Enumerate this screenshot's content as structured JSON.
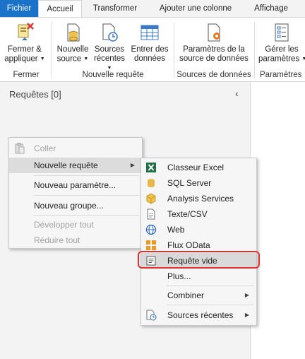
{
  "ribbon_tabs": [
    "Fichier",
    "Accueil",
    "Transformer",
    "Ajouter une colonne",
    "Affichage"
  ],
  "ribbon": {
    "close_apply": {
      "line1": "Fermer &",
      "line2": "appliquer"
    },
    "new_source": {
      "line1": "Nouvelle",
      "line2": "source"
    },
    "recent_sources": {
      "line1": "Sources",
      "line2": "récentes"
    },
    "enter_data": {
      "line1": "Entrer des",
      "line2": "données"
    },
    "data_source_settings": {
      "line1": "Paramètres de la",
      "line2": "source de données"
    },
    "manage_params": {
      "line1": "Gérer les",
      "line2": "paramètres"
    },
    "groups": {
      "close": "Fermer",
      "new_query": "Nouvelle requête",
      "data_sources": "Sources de données",
      "params": "Paramètres"
    }
  },
  "queries_pane": {
    "title": "Requêtes [0]",
    "collapse_icon": "chevron-left-icon"
  },
  "context_menu": {
    "items": [
      {
        "label": "Coller",
        "disabled": true
      },
      {
        "label": "Nouvelle requête",
        "submenu": true
      },
      {
        "label": "Nouveau paramètre..."
      },
      {
        "label": "Nouveau groupe..."
      },
      {
        "label": "Développer tout",
        "disabled": true
      },
      {
        "label": "Réduire tout",
        "disabled": true
      }
    ]
  },
  "submenu": {
    "items": [
      {
        "label": "Classeur Excel",
        "icon": "excel-icon"
      },
      {
        "label": "SQL Server",
        "icon": "database-icon"
      },
      {
        "label": "Analysis Services",
        "icon": "cube-icon"
      },
      {
        "label": "Texte/CSV",
        "icon": "text-file-icon"
      },
      {
        "label": "Web",
        "icon": "globe-icon"
      },
      {
        "label": "Flux OData",
        "icon": "odata-icon"
      },
      {
        "label": "Requête vide",
        "icon": "blank-query-icon"
      },
      {
        "label": "Plus..."
      },
      {
        "label": "Combiner"
      },
      {
        "label": "Sources récentes",
        "icon": "recent-sources-icon"
      }
    ],
    "selected": "Requête vide"
  },
  "colors": {
    "file_tab": "#1a73c8",
    "highlight": "#e03030",
    "excel": "#1e7145",
    "sql": "#e8b84a"
  }
}
